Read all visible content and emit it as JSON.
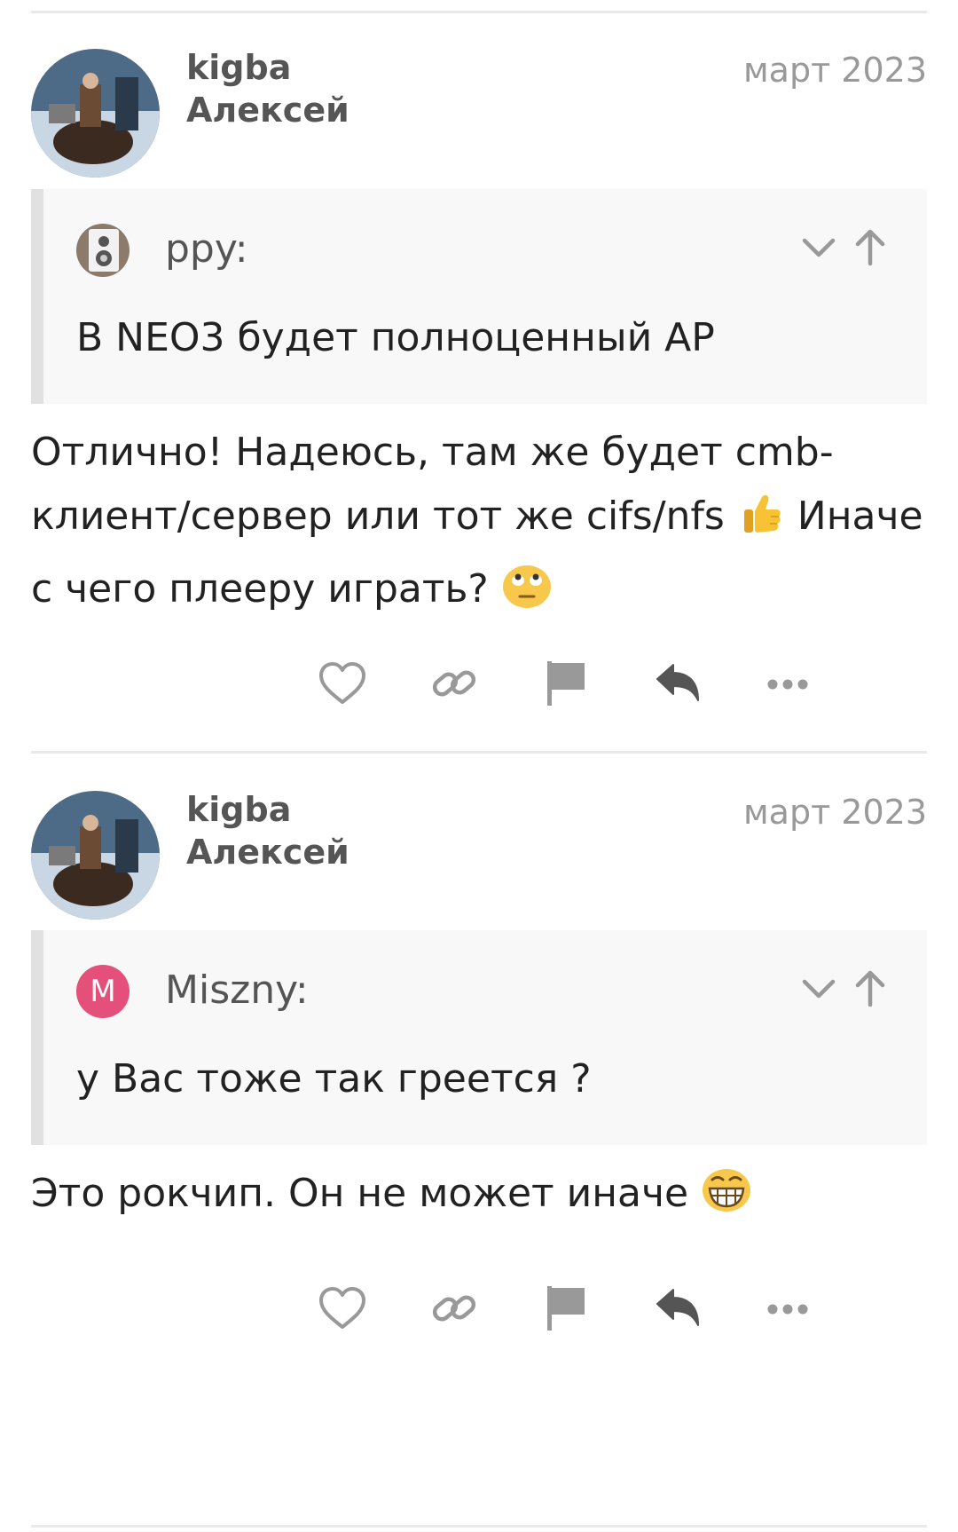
{
  "colors": {
    "text": "#222222",
    "muted": "#999999",
    "username": "#555555",
    "quote_bg": "#f8f8f8",
    "quote_border": "#e1e1e1",
    "icon": "#999999",
    "reply_icon": "#555555",
    "m_avatar": "#e4507a"
  },
  "posts": [
    {
      "username": "kigba",
      "full_name": "Алексей",
      "date": "март 2023",
      "quote": {
        "author": "ppy:",
        "text": "В NEO3 будет полноценный AP"
      },
      "body_parts": [
        "Отлично! Надеюсь, там же будет cmb-клиент/сервер или тот же cifs/nfs ",
        " Иначе с чего плееру играть? "
      ],
      "emojis": [
        "thumbs-up",
        "rolling-eyes"
      ]
    },
    {
      "username": "kigba",
      "full_name": "Алексей",
      "date": "март 2023",
      "quote": {
        "author": "Miszny:",
        "avatar_letter": "M",
        "text": "у Вас тоже так греется ?"
      },
      "body_parts": [
        "Это рокчип. Он не может иначе "
      ],
      "emojis": [
        "grinning-face"
      ]
    }
  ],
  "actions": [
    "like",
    "copy-link",
    "flag",
    "reply",
    "more"
  ]
}
